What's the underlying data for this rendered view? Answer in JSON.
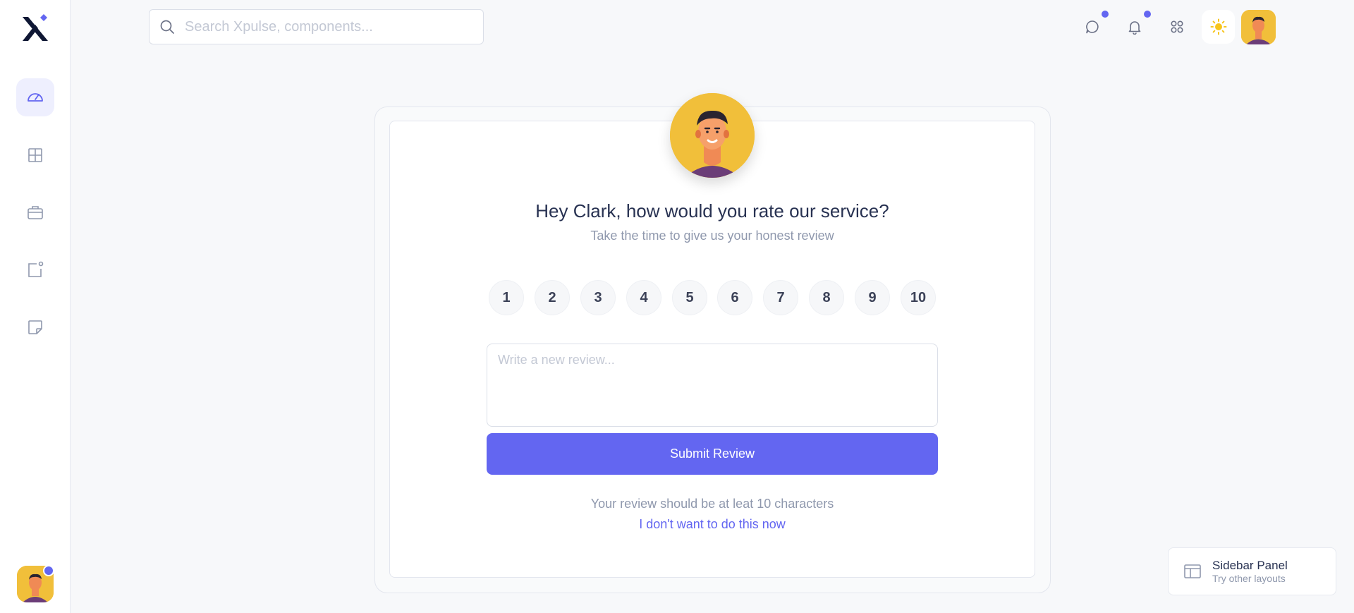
{
  "header": {
    "search_placeholder": "Search Xpulse, components...",
    "icons": [
      "chat-icon",
      "bell-icon",
      "apps-grid-icon",
      "sun-icon"
    ]
  },
  "sidebar": {
    "items": [
      {
        "icon": "speedometer-icon",
        "active": true
      },
      {
        "icon": "layout-grid-icon",
        "active": false
      },
      {
        "icon": "briefcase-icon",
        "active": false
      },
      {
        "icon": "square-dot-icon",
        "active": false
      },
      {
        "icon": "sticky-note-icon",
        "active": false
      }
    ]
  },
  "review": {
    "title": "Hey Clark, how would you rate our service?",
    "subtitle": "Take the time to give us your honest review",
    "ratings": [
      "1",
      "2",
      "3",
      "4",
      "5",
      "6",
      "7",
      "8",
      "9",
      "10"
    ],
    "textarea_placeholder": "Write a new review...",
    "submit_label": "Submit Review",
    "hint": "Your review should be at leat 10 characters",
    "skip_label": "I don't want to do this now"
  },
  "panel_widget": {
    "title": "Sidebar Panel",
    "subtitle": "Try other layouts"
  },
  "colors": {
    "accent": "#6366f1",
    "avatar_bg": "#f1bf3a",
    "background": "#f7f8fa"
  }
}
